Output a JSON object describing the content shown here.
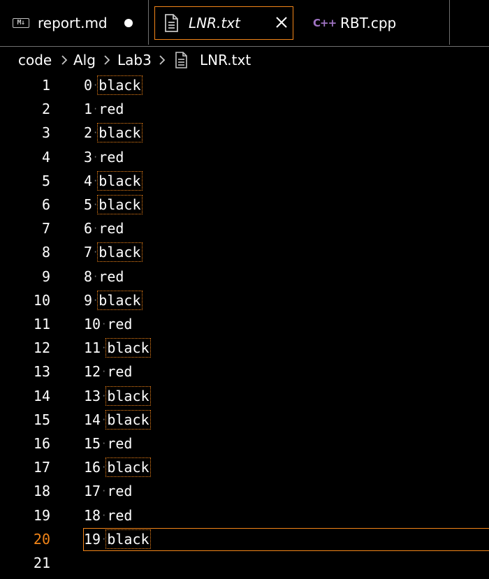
{
  "colors": {
    "background": "#000000",
    "text": "#ffffff",
    "active_border": "#f38518",
    "active_line_number": "#f38518",
    "markdown_icon": "#c5c5c5",
    "cpp_icon": "#a074c4",
    "whitespace_dot": "#7a7a7a",
    "tab_divider": "#6f6f6f"
  },
  "tabs": [
    {
      "label": "report.md",
      "icon": "markdown-icon",
      "badge": "M↓",
      "dirty": true,
      "active": false
    },
    {
      "label": "LNR.txt",
      "icon": "file-text-icon",
      "dirty": false,
      "active": true,
      "preview": true
    },
    {
      "label": "RBT.cpp",
      "icon": "cpp-icon",
      "badge": "C++",
      "dirty": false,
      "active": false
    }
  ],
  "breadcrumb": {
    "items": [
      "code",
      "Alg",
      "Lab3",
      "LNR.txt"
    ],
    "separator_icon": "chevron-right-icon",
    "file_icon": "file-text-icon"
  },
  "editor": {
    "active_line": 20,
    "lines": [
      {
        "n": "1",
        "key": "0",
        "value": "black"
      },
      {
        "n": "2",
        "key": "1",
        "value": "red"
      },
      {
        "n": "3",
        "key": "2",
        "value": "black"
      },
      {
        "n": "4",
        "key": "3",
        "value": "red"
      },
      {
        "n": "5",
        "key": "4",
        "value": "black"
      },
      {
        "n": "6",
        "key": "5",
        "value": "black"
      },
      {
        "n": "7",
        "key": "6",
        "value": "red"
      },
      {
        "n": "8",
        "key": "7",
        "value": "black"
      },
      {
        "n": "9",
        "key": "8",
        "value": "red"
      },
      {
        "n": "10",
        "key": "9",
        "value": "black"
      },
      {
        "n": "11",
        "key": "10",
        "value": "red"
      },
      {
        "n": "12",
        "key": "11",
        "value": "black"
      },
      {
        "n": "13",
        "key": "12",
        "value": "red"
      },
      {
        "n": "14",
        "key": "13",
        "value": "black"
      },
      {
        "n": "15",
        "key": "14",
        "value": "black"
      },
      {
        "n": "16",
        "key": "15",
        "value": "red"
      },
      {
        "n": "17",
        "key": "16",
        "value": "black"
      },
      {
        "n": "18",
        "key": "17",
        "value": "red"
      },
      {
        "n": "19",
        "key": "18",
        "value": "red"
      },
      {
        "n": "20",
        "key": "19",
        "value": "black"
      },
      {
        "n": "21",
        "key": "",
        "value": ""
      }
    ]
  }
}
